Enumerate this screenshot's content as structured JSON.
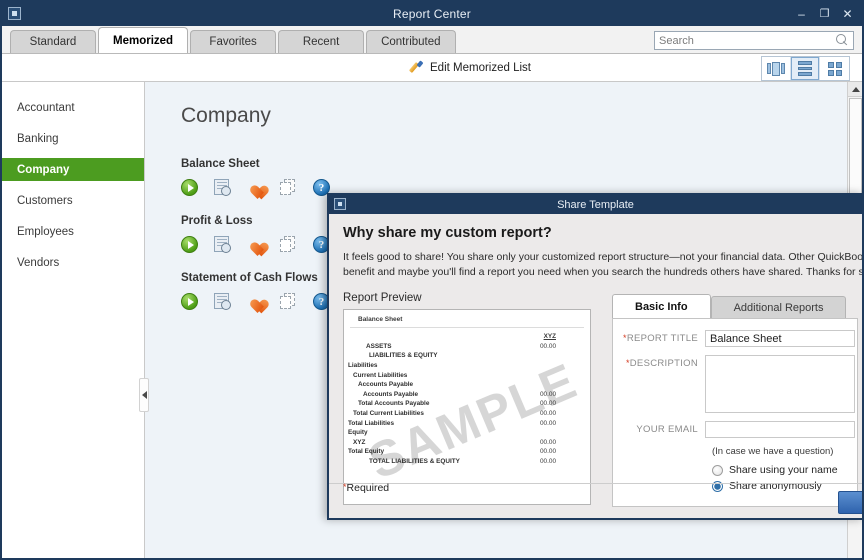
{
  "window": {
    "title": "Report Center",
    "icon": "window-menu-icon",
    "controls": {
      "minimize": "–",
      "maximize": "❐",
      "close": "✕"
    }
  },
  "tabs": [
    {
      "label": "Standard",
      "active": false
    },
    {
      "label": "Memorized",
      "active": true
    },
    {
      "label": "Favorites",
      "active": false
    },
    {
      "label": "Recent",
      "active": false
    },
    {
      "label": "Contributed",
      "active": false
    }
  ],
  "search": {
    "placeholder": "Search",
    "value": "",
    "icon": "search-icon"
  },
  "toolbar": {
    "edit_link": "Edit Memorized List",
    "edit_icon": "pencil-icon",
    "views": [
      {
        "name": "carousel-view",
        "label": "Carousel View",
        "active": false
      },
      {
        "name": "list-view",
        "label": "List View",
        "active": true
      },
      {
        "name": "grid-view",
        "label": "Grid View",
        "active": false
      }
    ]
  },
  "sidebar": {
    "items": [
      {
        "label": "Accountant",
        "active": false
      },
      {
        "label": "Banking",
        "active": false
      },
      {
        "label": "Company",
        "active": true
      },
      {
        "label": "Customers",
        "active": false
      },
      {
        "label": "Employees",
        "active": false
      },
      {
        "label": "Vendors",
        "active": false
      }
    ],
    "collapse_icon": "collapse-left-arrow-icon",
    "active_color": "#4c9c20"
  },
  "main": {
    "page_title": "Company",
    "reports": [
      {
        "name": "Balance Sheet",
        "icons": [
          {
            "name": "run-report-icon",
            "label": "Run"
          },
          {
            "name": "preview-report-icon",
            "label": "Preview"
          },
          {
            "name": "favorite-heart-icon",
            "label": "Mark as Favorite"
          },
          {
            "name": "share-template-icon",
            "label": "Share Template"
          },
          {
            "name": "help-icon",
            "label": "Help"
          }
        ],
        "annotated": true
      },
      {
        "name": "Profit & Loss",
        "icons": [
          {
            "name": "run-report-icon",
            "label": "Run"
          },
          {
            "name": "preview-report-icon",
            "label": "Preview"
          },
          {
            "name": "favorite-heart-icon",
            "label": "Mark as Favorite"
          },
          {
            "name": "share-template-icon",
            "label": "Share Template"
          },
          {
            "name": "help-icon",
            "label": "Help"
          }
        ],
        "annotated": false
      },
      {
        "name": "Statement of Cash Flows",
        "icons": [
          {
            "name": "run-report-icon",
            "label": "Run"
          },
          {
            "name": "preview-report-icon",
            "label": "Preview"
          },
          {
            "name": "favorite-heart-icon",
            "label": "Mark as Favorite"
          },
          {
            "name": "share-template-icon",
            "label": "Share Template"
          },
          {
            "name": "help-icon",
            "label": "Help"
          }
        ],
        "annotated": false
      }
    ]
  },
  "dialog": {
    "title": "Share Template",
    "icon": "window-menu-icon",
    "heading": "Why share my custom report?",
    "paragraph": "It feels good to share! You share only your customized report structure—not your financial data. Other QuickBooks users benefit and maybe you'll find a report you need when you search the hundreds others have shared. Thanks for sharing!",
    "preview_label": "Report Preview",
    "preview": {
      "title": "Balance Sheet",
      "watermark": "SAMPLE",
      "column_header": "XYZ",
      "rows": [
        {
          "label": "ASSETS",
          "amount": "00.00",
          "indent": 3,
          "bold": true,
          "header": true
        },
        {
          "label": "LIABILITIES & EQUITY",
          "amount": "",
          "indent": 3,
          "bold": true
        },
        {
          "label": "Liabilities",
          "amount": "",
          "indent": 0
        },
        {
          "label": "Current Liabilities",
          "amount": "",
          "indent": 1
        },
        {
          "label": "Accounts Payable",
          "amount": "",
          "indent": 2
        },
        {
          "label": "Accounts Payable",
          "amount": "00.00",
          "indent": 3
        },
        {
          "label": "Total Accounts Payable",
          "amount": "00.00",
          "indent": 2
        },
        {
          "label": "Total Current Liabilities",
          "amount": "00.00",
          "indent": 1
        },
        {
          "label": "Total Liabilities",
          "amount": "00.00",
          "indent": 0
        },
        {
          "label": "Equity",
          "amount": "",
          "indent": 0
        },
        {
          "label": "XYZ",
          "amount": "00.00",
          "indent": 1
        },
        {
          "label": "Total Equity",
          "amount": "00.00",
          "indent": 0
        },
        {
          "label": "TOTAL LIABILITIES & EQUITY",
          "amount": "00.00",
          "indent": 3,
          "bold": true
        }
      ]
    },
    "form": {
      "tabs": [
        {
          "label": "Basic Info",
          "active": true
        },
        {
          "label": "Additional Reports",
          "active": false
        }
      ],
      "fields": [
        {
          "name": "report-title",
          "label": "REPORT TITLE",
          "required": true,
          "value": "Balance Sheet"
        },
        {
          "name": "description",
          "label": "DESCRIPTION",
          "required": true,
          "value": ""
        },
        {
          "name": "your-email",
          "label": "YOUR EMAIL",
          "required": false,
          "value": ""
        }
      ],
      "email_hint": "(In case we have a question)",
      "radios": [
        {
          "label": "Share using your name",
          "selected": false
        },
        {
          "label": "Share anonymously",
          "selected": true
        }
      ],
      "required_note": "Required"
    },
    "footer_button": {
      "name": "share-submit-button",
      "label": ""
    }
  }
}
